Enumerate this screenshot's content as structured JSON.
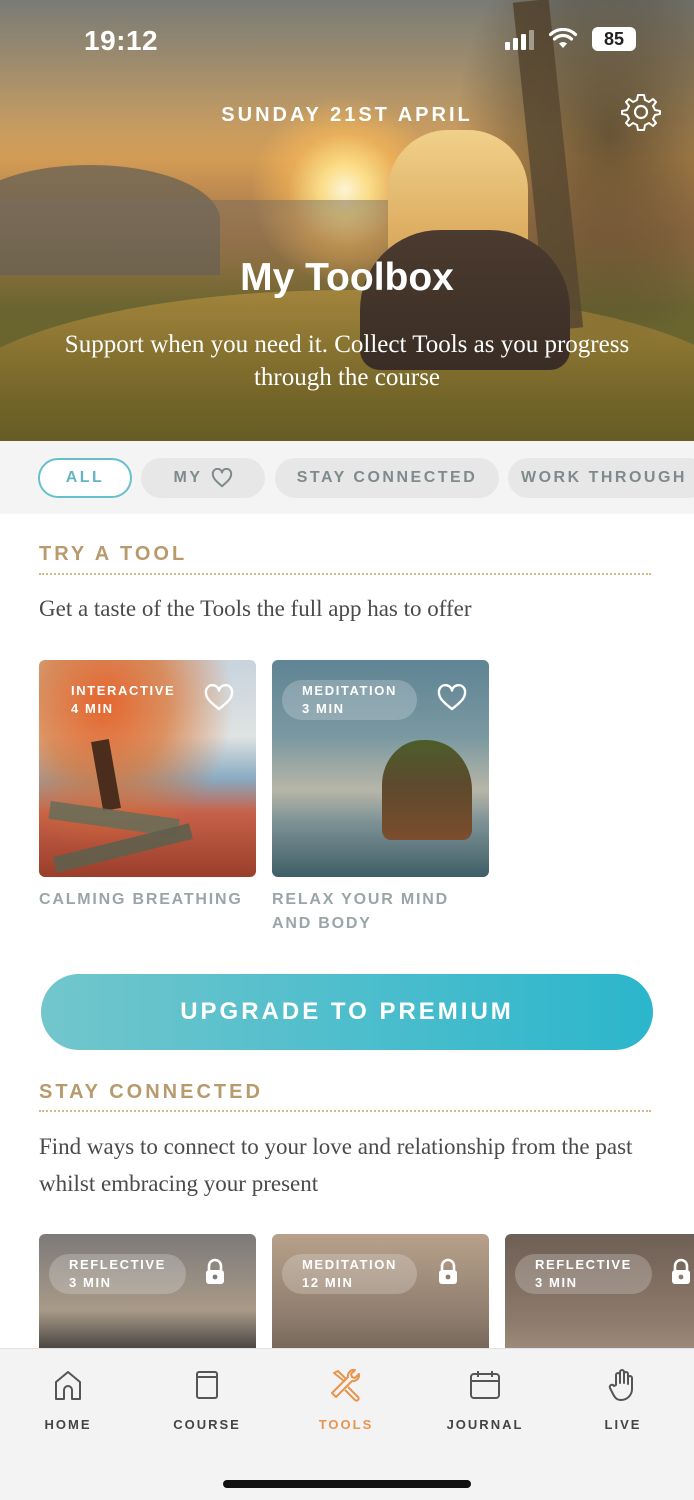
{
  "status_bar": {
    "time": "19:12",
    "battery": "85"
  },
  "hero": {
    "date": "SUNDAY 21ST APRIL",
    "title": "My Toolbox",
    "subtitle": "Support when you need it. Collect Tools as you progress through the course"
  },
  "filters": [
    {
      "label": "ALL",
      "active": true
    },
    {
      "label": "MY",
      "icon": "heart-icon",
      "active": false
    },
    {
      "label": "STAY CONNECTED",
      "active": false
    },
    {
      "label": "WORK THROUGH",
      "active": false
    }
  ],
  "try_tool": {
    "title": "TRY A TOOL",
    "description": "Get a taste of the Tools the full app has to offer",
    "cards": [
      {
        "type": "INTERACTIVE",
        "duration": "4 MIN",
        "label": "CALMING BREATHING",
        "icon": "heart-icon"
      },
      {
        "type": "MEDITATION",
        "duration": "3 MIN",
        "label": "RELAX YOUR MIND AND BODY",
        "icon": "heart-icon"
      }
    ]
  },
  "upgrade_button": "UPGRADE TO PREMIUM",
  "stay_connected": {
    "title": "STAY CONNECTED",
    "description": "Find ways to connect to your love and relationship from the past whilst embracing your present",
    "cards": [
      {
        "type": "REFLECTIVE",
        "duration": "3 MIN",
        "icon": "lock-icon"
      },
      {
        "type": "MEDITATION",
        "duration": "12 MIN",
        "icon": "lock-icon"
      },
      {
        "type": "REFLECTIVE",
        "duration": "3 MIN",
        "icon": "lock-icon"
      }
    ]
  },
  "tab_bar": [
    {
      "label": "HOME",
      "icon": "home-icon",
      "active": false
    },
    {
      "label": "COURSE",
      "icon": "book-icon",
      "active": false
    },
    {
      "label": "TOOLS",
      "icon": "tools-icon",
      "active": true
    },
    {
      "label": "JOURNAL",
      "icon": "calendar-icon",
      "active": false
    },
    {
      "label": "LIVE",
      "icon": "hand-icon",
      "active": false
    }
  ],
  "colors": {
    "accent_teal": "#2bb6cc",
    "section_gold": "#b89a6c",
    "active_tab": "#e8954f"
  }
}
